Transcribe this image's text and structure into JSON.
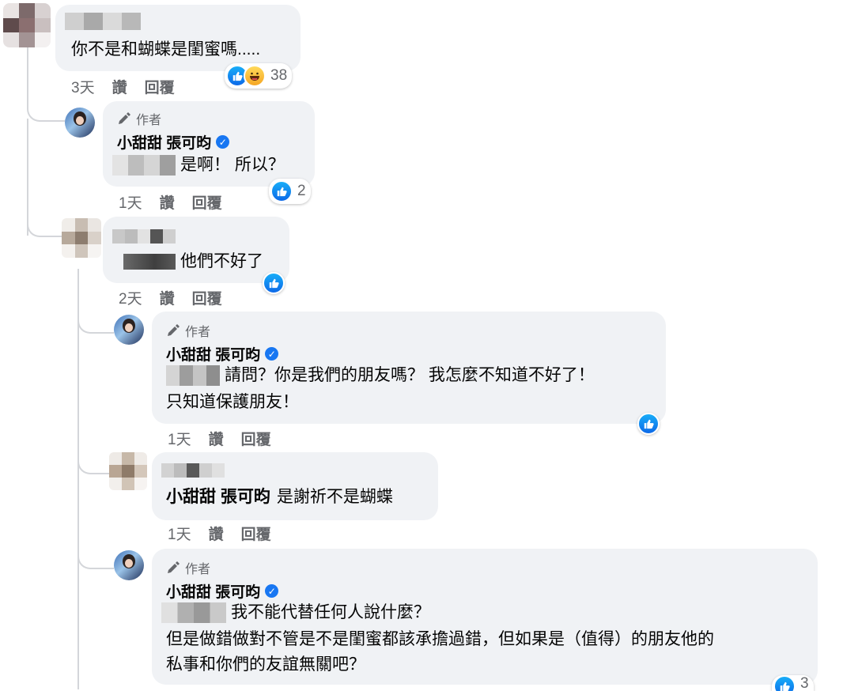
{
  "comments": [
    {
      "name_hidden": true,
      "text": "你不是和蝴蝶是閨蜜嗎.....",
      "time": "3天",
      "like_label": "讚",
      "reply_label": "回覆",
      "reaction_count": "38",
      "reactions": [
        "like-icon",
        "haha-icon"
      ]
    },
    {
      "author_badge": "作者",
      "name": "小甜甜 張可昀",
      "verified": true,
      "text": "是啊！ 所以？",
      "time": "1天",
      "like_label": "讚",
      "reply_label": "回覆",
      "reaction_count": "2"
    },
    {
      "name_hidden": true,
      "text": "他們不好了",
      "time": "2天",
      "like_label": "讚",
      "reply_label": "回覆",
      "reaction_count": ""
    },
    {
      "author_badge": "作者",
      "name": "小甜甜 張可昀",
      "verified": true,
      "text_line1": "請問？你是我們的朋友嗎？ 我怎麼不知道不好了！",
      "text_line2": "只知道保護朋友！",
      "time": "1天",
      "like_label": "讚",
      "reply_label": "回覆",
      "reaction_count": ""
    },
    {
      "name_hidden": true,
      "mention": "小甜甜 張可昀",
      "text": "是謝祈不是蝴蝶",
      "time": "1天",
      "like_label": "讚",
      "reply_label": "回覆"
    },
    {
      "author_badge": "作者",
      "name": "小甜甜 張可昀",
      "verified": true,
      "text_line1": "我不能代替任何人說什麼？",
      "text_line2": "但是做錯做對不管是不是閨蜜都該承擔過錯，但如果是（值得）的朋友他的",
      "text_line3": "私事和你們的友誼無關吧？",
      "reaction_count": "3"
    }
  ],
  "colors": {
    "bubble": "#f0f2f5",
    "like_blue": "#1877f2",
    "meta_gray": "#65676b",
    "thread_line": "#d4d6da"
  }
}
